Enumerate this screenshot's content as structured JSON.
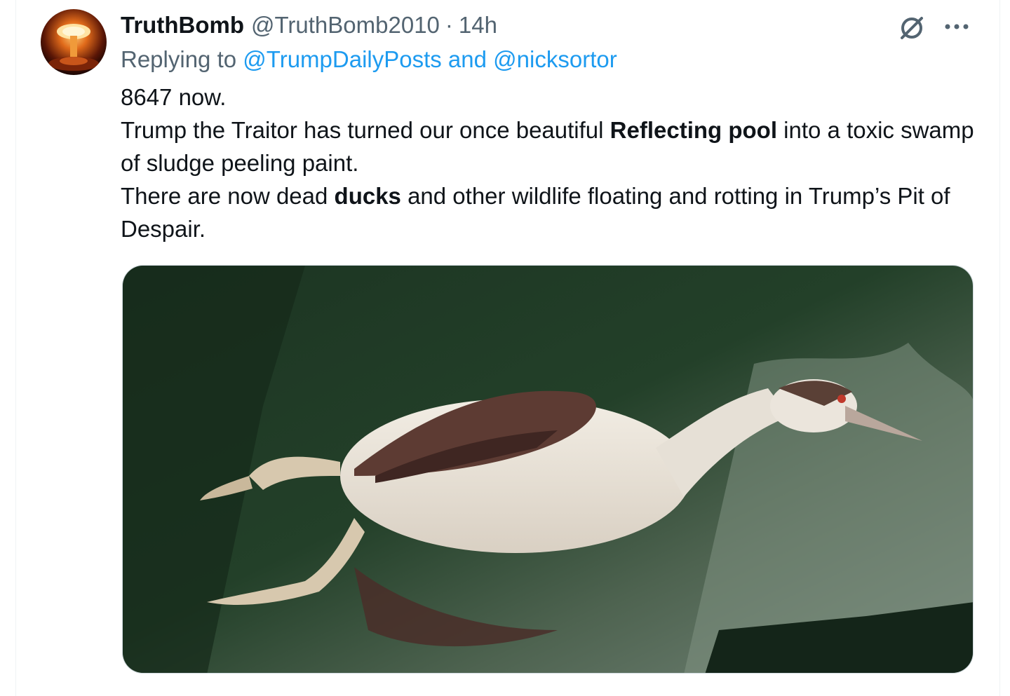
{
  "tweet": {
    "author": {
      "display_name": "TruthBomb",
      "handle": "@TruthBomb2010",
      "avatar_icon": "mushroom-cloud-avatar"
    },
    "separator": "·",
    "time": "14h",
    "reply": {
      "prefix": "Replying to ",
      "mention1": "@TrumpDailyPosts",
      "conjunction": " and ",
      "mention2": "@nicksortor"
    },
    "text": {
      "line1": "8647 now.",
      "para2_a": "Trump the Traitor has turned our once beautiful ",
      "para2_bold": "Reflecting pool",
      "para2_b": " into a toxic swamp of sludge peeling paint.",
      "para3_a": "There are now dead ",
      "para3_bold": "ducks",
      "para3_b": " and other wildlife floating and rotting in Trump’s Pit of Despair."
    },
    "actions": {
      "grok_icon": "grok-icon",
      "more_icon": "more-icon"
    },
    "media": {
      "icon": "dead-bird-photo"
    }
  },
  "colors": {
    "text_primary": "#0f1419",
    "text_secondary": "#536471",
    "link": "#1d9bf0",
    "water_dark": "#1f3a26",
    "water_light": "#6b7d6c"
  }
}
